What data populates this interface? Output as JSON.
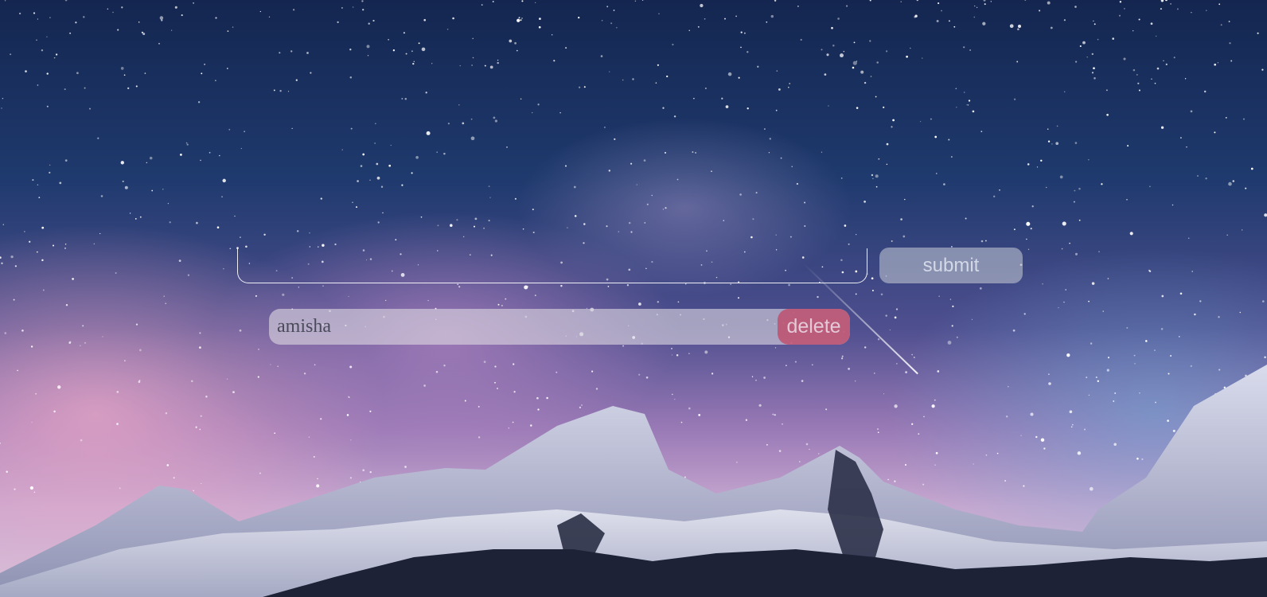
{
  "form": {
    "input_value": "",
    "submit_label": "submit"
  },
  "todos": [
    {
      "text": "amisha",
      "delete_label": "delete"
    }
  ]
}
